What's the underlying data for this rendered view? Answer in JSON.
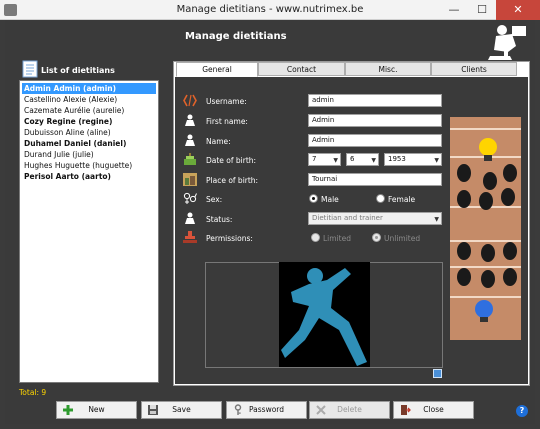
{
  "window": {
    "title": "Manage dietitians - www.nutrimex.be",
    "minimize": "—",
    "maximize": "☐",
    "close": "✕"
  },
  "header": {
    "title": "Manage dietitians"
  },
  "list": {
    "label": "List of dietitians",
    "items": [
      {
        "text": "Admin Admin (admin)",
        "style": "selected"
      },
      {
        "text": "Castellino  Alexie (Alexie)",
        "style": "normal"
      },
      {
        "text": "Cazemate Aurélie (aurelie)",
        "style": "normal"
      },
      {
        "text": "Cozy Regine (regine)",
        "style": "bold"
      },
      {
        "text": "Dubuisson Aline (aline)",
        "style": "normal"
      },
      {
        "text": "Duhamel Daniel (daniel)",
        "style": "bold"
      },
      {
        "text": "Durand Julie (julie)",
        "style": "normal"
      },
      {
        "text": "Hughes Huguette (huguette)",
        "style": "normal"
      },
      {
        "text": "Perisol Aarto (aarto)",
        "style": "bold"
      }
    ],
    "total": "Total: 9"
  },
  "tabs": [
    {
      "label": "General",
      "active": true
    },
    {
      "label": "Contact",
      "active": false
    },
    {
      "label": "Misc.",
      "active": false
    },
    {
      "label": "Clients",
      "active": false
    }
  ],
  "form": {
    "username_label": "Username:",
    "username_value": "admin",
    "firstname_label": "First name:",
    "firstname_value": "Admin",
    "name_label": "Name:",
    "name_value": "Admin",
    "dob_label": "Date of birth:",
    "dob_day": "7",
    "dob_month": "6",
    "dob_year": "1953",
    "pob_label": "Place of birth:",
    "pob_value": "Tournai",
    "sex_label": "Sex:",
    "sex_male": "Male",
    "sex_female": "Female",
    "status_label": "Status:",
    "status_value": "Dietitian and trainer",
    "permissions_label": "Permissions:",
    "perm_limited": "Limited",
    "perm_unlimited": "Unlimited"
  },
  "buttons": {
    "new": "New",
    "save": "Save",
    "password": "Password",
    "delete": "Delete",
    "close": "Close",
    "help": "?"
  },
  "colors": {
    "selection": "#3399ff",
    "total_text": "#ffd600",
    "close_button": "#c7463b",
    "side_image_bg": "#c58b68",
    "photo_figure": "#2f8fb7"
  }
}
